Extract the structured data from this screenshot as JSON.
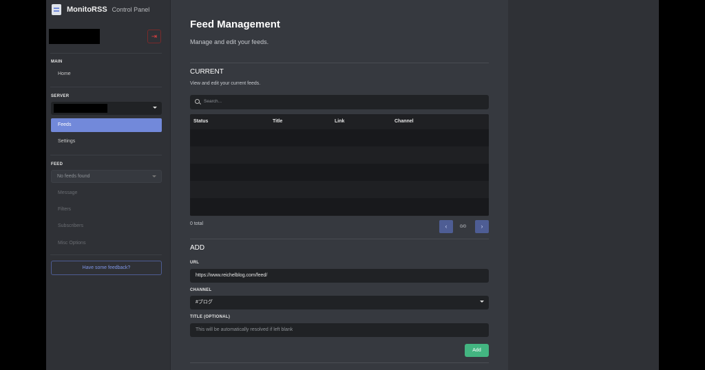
{
  "brand": {
    "name": "MonitoRSS",
    "subtitle": "Control Panel"
  },
  "sidebar": {
    "main_heading": "MAIN",
    "home_label": "Home",
    "server_heading": "SERVER",
    "feeds_label": "Feeds",
    "settings_label": "Settings",
    "feed_heading": "FEED",
    "feed_select_value": "No feeds found",
    "feed_items": [
      "Message",
      "Filters",
      "Subscribers",
      "Misc Options"
    ],
    "feedback_label": "Have some feedback?"
  },
  "main": {
    "title": "Feed Management",
    "subtitle": "Manage and edit your feeds.",
    "current": {
      "title": "CURRENT",
      "subtitle": "View and edit your current feeds.",
      "search_placeholder": "Search...",
      "columns": [
        "Status",
        "Title",
        "Link",
        "Channel"
      ],
      "total": "0 total",
      "page": "0/0",
      "prev_glyph": "‹",
      "next_glyph": "›"
    },
    "add": {
      "title": "ADD",
      "url_label": "URL",
      "url_value": "https://www.reichelblog.com/feed/",
      "channel_label": "CHANNEL",
      "channel_value": "#ブログ",
      "title_label": "TITLE (OPTIONAL)",
      "title_placeholder": "This will be automatically resolved if left blank",
      "add_button": "Add"
    }
  },
  "colors": {
    "accent": "#7289da",
    "success": "#43b581",
    "danger": "#e04040",
    "background": "#36393f",
    "sidebar": "#2f3136"
  }
}
